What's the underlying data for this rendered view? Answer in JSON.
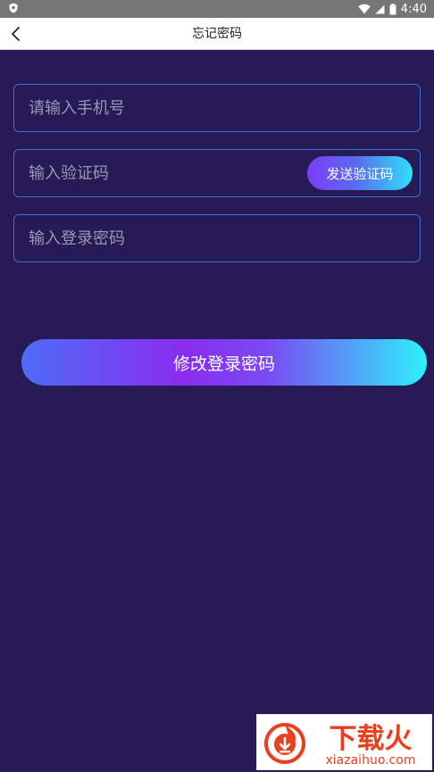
{
  "status_bar": {
    "time": "4:40",
    "icons": [
      "shield-icon",
      "wifi-icon",
      "signal-icon",
      "battery-icon"
    ]
  },
  "header": {
    "title": "忘记密码",
    "back_icon": "chevron-left-icon"
  },
  "form": {
    "phone": {
      "placeholder": "请输入手机号",
      "value": ""
    },
    "code": {
      "placeholder": "输入验证码",
      "value": "",
      "send_label": "发送验证码"
    },
    "password": {
      "placeholder": "输入登录密码",
      "value": ""
    },
    "submit_label": "修改登录密码"
  },
  "watermark": {
    "brand": "下载火",
    "domain": "xiazaihuo.com"
  },
  "colors": {
    "background": "#261b55",
    "field_border": "#3c6fd0",
    "gradient_start": "#7b3cf5",
    "gradient_end": "#2ee0f8",
    "watermark_red": "#e8401f"
  }
}
